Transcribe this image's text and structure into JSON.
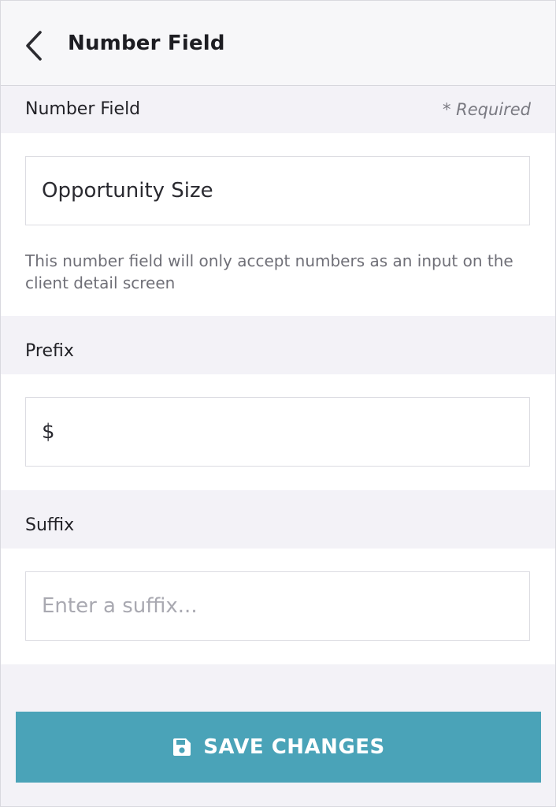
{
  "header": {
    "title": "Number Field"
  },
  "number_field_section": {
    "label": "Number Field",
    "required": "* Required",
    "value": "Opportunity Size",
    "helper": "This number field will only accept numbers as an input on the client detail screen"
  },
  "prefix_section": {
    "label": "Prefix",
    "value": "$"
  },
  "suffix_section": {
    "label": "Suffix",
    "value": "",
    "placeholder": "Enter a suffix..."
  },
  "footer": {
    "save_label": "SAVE CHANGES"
  },
  "icons": {
    "back": "chevron-left-icon",
    "save": "floppy-disk-icon"
  },
  "colors": {
    "accent": "#4aa3b8",
    "section_bg": "#f3f2f7",
    "header_bg": "#f7f7f9"
  }
}
